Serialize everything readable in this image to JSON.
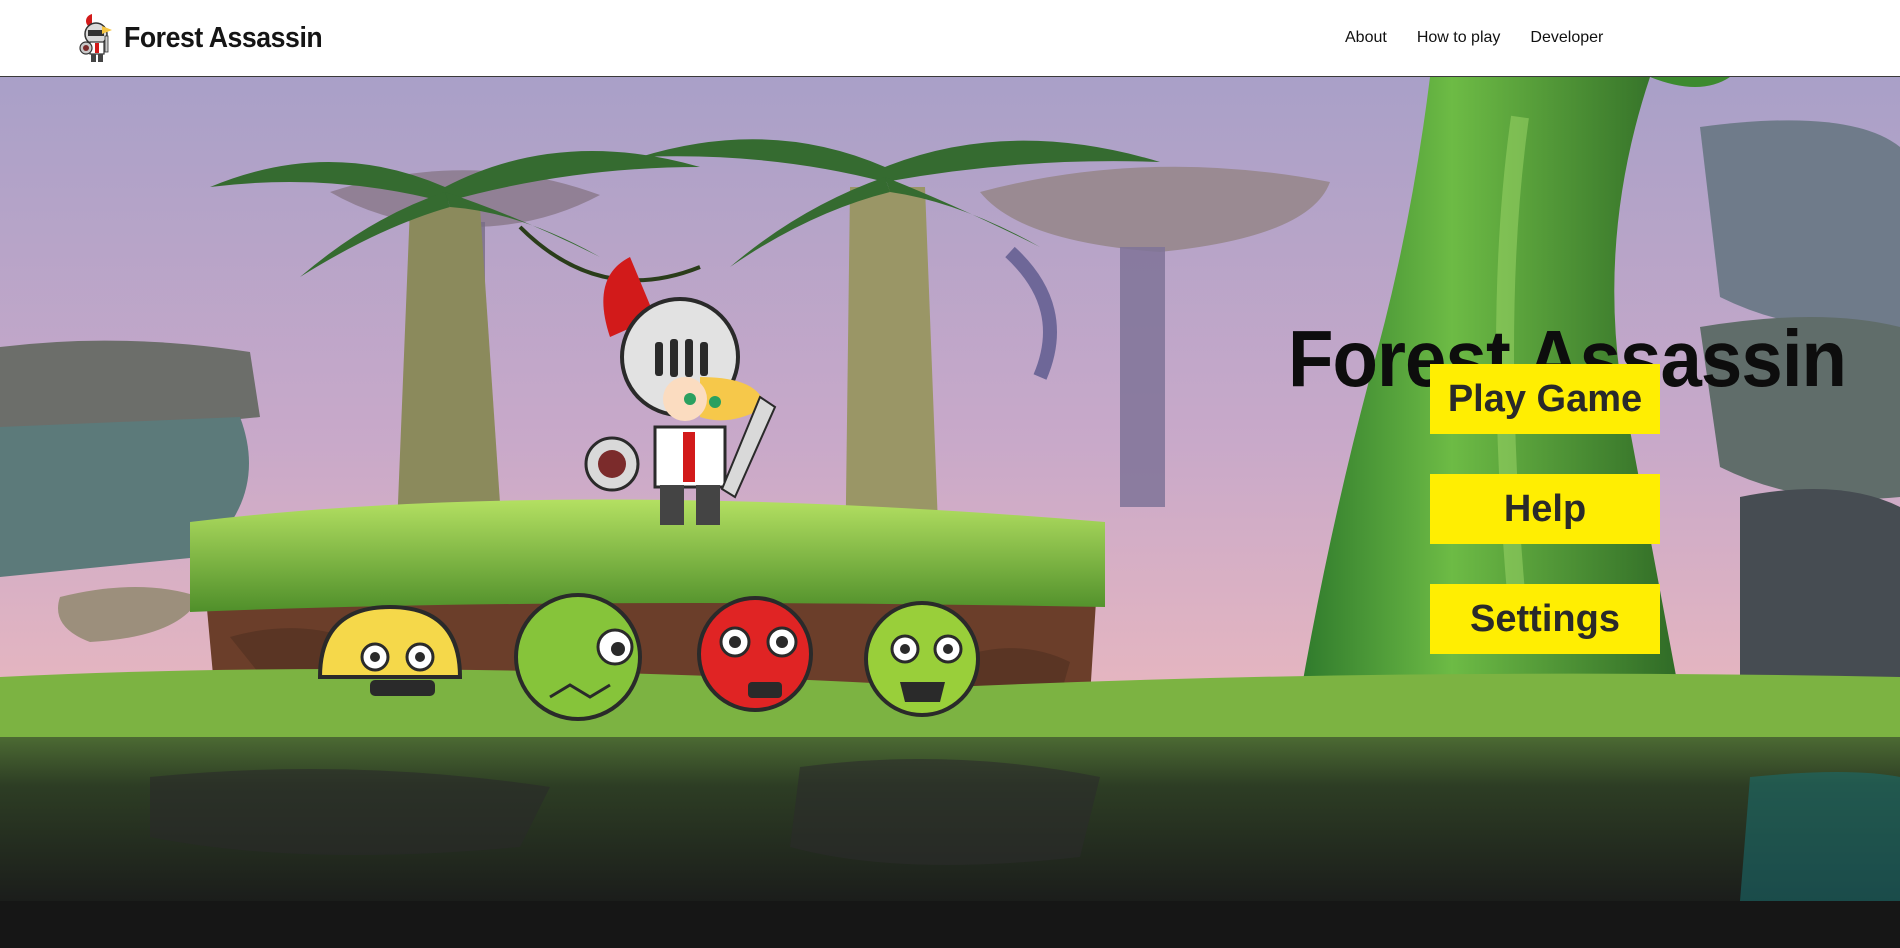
{
  "nav": {
    "brand": "Forest Assassin",
    "links": [
      "About",
      "How to play",
      "Developer"
    ]
  },
  "menu": {
    "title": "Forest Assassin",
    "buttons": [
      "Play Game",
      "Help",
      "Settings"
    ]
  },
  "colors": {
    "button": "#ffee02",
    "fullscreen_icon": "#1ec8e8"
  },
  "icons": {
    "logo": "knight-icon",
    "fullscreen": "fullscreen-icon"
  }
}
